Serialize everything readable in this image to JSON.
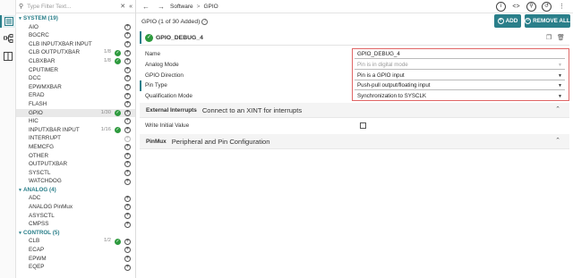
{
  "tree": {
    "filter_placeholder": "Type Filter Text...",
    "categories": [
      {
        "label": "SYSTEM (19)",
        "modules": [
          {
            "name": "AIO",
            "count": "",
            "added": false,
            "enabled": true
          },
          {
            "name": "BGCRC",
            "count": "",
            "added": false,
            "enabled": true
          },
          {
            "name": "CLB INPUTXBAR INPUT",
            "count": "",
            "added": false,
            "enabled": true
          },
          {
            "name": "CLB OUTPUTXBAR",
            "count": "1/8",
            "added": true,
            "enabled": true
          },
          {
            "name": "CLBXBAR",
            "count": "1/8",
            "added": true,
            "enabled": true
          },
          {
            "name": "CPUTIMER",
            "count": "",
            "added": false,
            "enabled": true
          },
          {
            "name": "DCC",
            "count": "",
            "added": false,
            "enabled": true
          },
          {
            "name": "EPWMXBAR",
            "count": "",
            "added": false,
            "enabled": true
          },
          {
            "name": "ERAD",
            "count": "",
            "added": false,
            "enabled": true
          },
          {
            "name": "FLASH",
            "count": "",
            "added": false,
            "enabled": true
          },
          {
            "name": "GPIO",
            "count": "1/30",
            "added": true,
            "enabled": true,
            "selected": true
          },
          {
            "name": "HIC",
            "count": "",
            "added": false,
            "enabled": true
          },
          {
            "name": "INPUTXBAR INPUT",
            "count": "1/16",
            "added": true,
            "enabled": true
          },
          {
            "name": "INTERRUPT",
            "count": "",
            "added": false,
            "enabled": false
          },
          {
            "name": "MEMCFG",
            "count": "",
            "added": false,
            "enabled": true
          },
          {
            "name": "OTHER",
            "count": "",
            "added": false,
            "enabled": true
          },
          {
            "name": "OUTPUTXBAR",
            "count": "",
            "added": false,
            "enabled": true
          },
          {
            "name": "SYSCTL",
            "count": "",
            "added": false,
            "enabled": true
          },
          {
            "name": "WATCHDOG",
            "count": "",
            "added": false,
            "enabled": true
          }
        ]
      },
      {
        "label": "ANALOG (4)",
        "modules": [
          {
            "name": "ADC",
            "count": "",
            "added": false,
            "enabled": true
          },
          {
            "name": "ANALOG PinMux",
            "count": "",
            "added": false,
            "enabled": true
          },
          {
            "name": "ASYSCTL",
            "count": "",
            "added": false,
            "enabled": true
          },
          {
            "name": "CMPSS",
            "count": "",
            "added": false,
            "enabled": true
          }
        ]
      },
      {
        "label": "CONTROL (5)",
        "modules": [
          {
            "name": "CLB",
            "count": "1/2",
            "added": true,
            "enabled": true
          },
          {
            "name": "ECAP",
            "count": "",
            "added": false,
            "enabled": true
          },
          {
            "name": "EPWM",
            "count": "",
            "added": false,
            "enabled": true
          },
          {
            "name": "EQEP",
            "count": "",
            "added": false,
            "enabled": true
          }
        ]
      }
    ]
  },
  "breadcrumb": {
    "software": "Software",
    "sep": ">",
    "current": "GPIO"
  },
  "module": {
    "title": "GPIO (1 of 30 Added)",
    "add_label": "ADD",
    "remove_label": "REMOVE ALL"
  },
  "instance": {
    "name": "GPIO_DEBUG_4"
  },
  "properties": [
    {
      "label": "Name",
      "value": "GPIO_DEBUG_4",
      "type": "text",
      "disabled": false
    },
    {
      "label": "Analog Mode",
      "value": "Pin is in digital mode",
      "type": "select",
      "disabled": true
    },
    {
      "label": "GPIO Direction",
      "value": "Pin is a GPIO input",
      "type": "select",
      "disabled": false
    },
    {
      "label": "Pin Type",
      "value": "Push-pull output/floating input",
      "type": "select",
      "disabled": false
    },
    {
      "label": "Qualification Mode",
      "value": "Synchronization to SYSCLK",
      "type": "select",
      "disabled": false
    }
  ],
  "external_interrupts": {
    "title": "External Interrupts",
    "description": "Connect to an XINT for interrupts"
  },
  "write_initial_value": {
    "label": "Write Initial Value",
    "checked": false
  },
  "pinmux": {
    "title": "PinMux",
    "description": "Peripheral and Pin Configuration"
  },
  "colors": {
    "accent": "#2a7f8a",
    "added": "#2e9a3e",
    "highlight": "#e06666"
  }
}
